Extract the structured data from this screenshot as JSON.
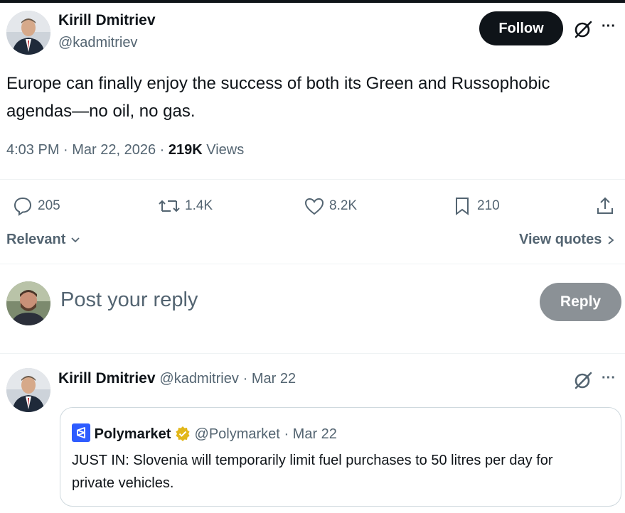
{
  "main_tweet": {
    "author_name": "Kirill Dmitriev",
    "author_handle": "@kadmitriev",
    "follow_label": "Follow",
    "more_label": "···",
    "text": "Europe can finally enjoy the success of both its Green and Russophobic agendas—no oil, no gas.",
    "time": "4:03 PM · Mar 22, 2026 · ",
    "views_count": "219K",
    "views_label": " Views",
    "actions": {
      "replies": "205",
      "reposts": "1.4K",
      "likes": "8.2K",
      "bookmarks": "210"
    }
  },
  "sort": {
    "relevant_label": "Relevant",
    "view_quotes_label": "View quotes"
  },
  "composer": {
    "placeholder": "Post your reply",
    "reply_label": "Reply"
  },
  "reply_tweet": {
    "author_name": "Kirill Dmitriev",
    "author_handle": "@kadmitriev",
    "date": "· Mar 22",
    "more_label": "···",
    "quote": {
      "author_name": "Polymarket",
      "author_handle": "@Polymarket",
      "date": "· Mar 22",
      "text": "JUST IN: Slovenia will temporarily limit fuel purchases to 50 litres per day for private vehicles."
    }
  },
  "colors": {
    "text_primary": "#0f1419",
    "text_secondary": "#536471",
    "reply_button_disabled": "#8b9196",
    "verified_gold": "#e2b719",
    "polymarket_blue": "#2e5cff"
  }
}
